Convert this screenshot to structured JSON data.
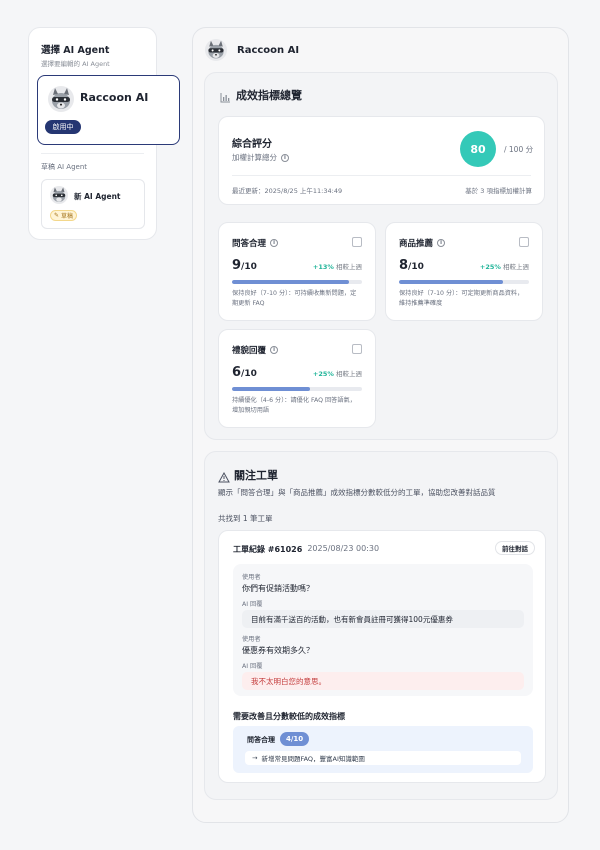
{
  "sidebar": {
    "title": "選擇 AI Agent",
    "subtitle": "選擇要編輯的 AI Agent",
    "active_agent": {
      "name": "Raccoon AI",
      "status": "啟用中"
    },
    "draft_section_title": "草稿 AI Agent",
    "draft_agent": {
      "name": "新 AI Agent",
      "status": "草稿"
    }
  },
  "main": {
    "agent_name": "Raccoon AI",
    "overview": {
      "title": "成效指標總覽",
      "score": {
        "title": "綜合評分",
        "subtitle": "加權計算總分",
        "value": "80",
        "total": "/ 100 分",
        "updated": "最近更新：2025/8/25 上午11:34:49",
        "basis": "基於 3 項指標加權計算"
      },
      "metrics": [
        {
          "title": "問答合理",
          "score": "9",
          "max": "/10",
          "change": "+13%",
          "change_suffix": " 相較上週",
          "progress": 0.9,
          "note": "保持良好（7-10 分）：可持續收集新問題，定期更新 FAQ"
        },
        {
          "title": "商品推薦",
          "score": "8",
          "max": "/10",
          "change": "+25%",
          "change_suffix": " 相較上週",
          "progress": 0.8,
          "note": "保持良好（7-10 分）：可定期更新商品資料，維持推薦準確度"
        },
        {
          "title": "禮貌回覆",
          "score": "6",
          "max": "/10",
          "change": "+25%",
          "change_suffix": " 相較上週",
          "progress": 0.6,
          "note": "持續優化（4-6 分）：請優化 FAQ 回答語氣，增加親切用語"
        }
      ]
    },
    "tickets": {
      "title": "關注工單",
      "description": "顯示「問答合理」與「商品推薦」成效指標分數較低分的工單，協助您改善對話品質",
      "count_text": "共找到 1 筆工單",
      "ticket": {
        "id": "工單紀錄 #61026",
        "time": "2025/08/23 00:30",
        "go_label": "前往對話",
        "messages": [
          {
            "role": "使用者",
            "text": "你們有促銷活動嗎？"
          },
          {
            "role": "AI 回覆",
            "text": "目前有滿千送百的活動，也有新會員註冊可獲得100元優惠券"
          },
          {
            "role": "使用者",
            "text": "優惠券有效期多久？"
          },
          {
            "role": "AI 回覆",
            "text": "我不太明白您的意思。"
          }
        ],
        "improve_title": "需要改善且分數較低的成效指標",
        "improve": {
          "metric": "問答合理",
          "score": "4/10",
          "suggestion": "新增常見問題FAQ，豐富AI知識範圍"
        }
      }
    }
  },
  "colors": {
    "brand": "#253672",
    "accent": "#34c9b8",
    "progress": "#6f8fd4",
    "positive": "#22b59a",
    "alert": "#c43c3c"
  }
}
